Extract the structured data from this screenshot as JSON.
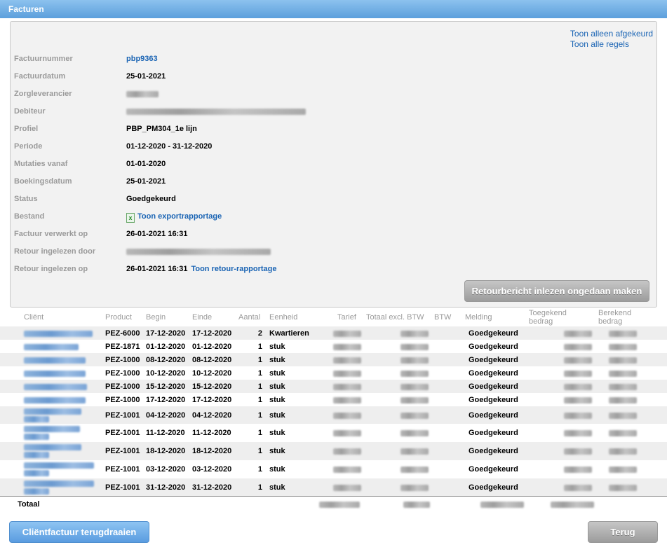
{
  "title": "Facturen",
  "links": {
    "only_rejected": "Toon alleen afgekeurd",
    "all_lines": "Toon alle regels"
  },
  "fields": [
    {
      "label": "Factuurnummer",
      "value": "pbp9363",
      "type": "link"
    },
    {
      "label": "Factuurdatum",
      "value": "25-01-2021",
      "type": "text"
    },
    {
      "label": "Zorgleverancier",
      "value": "",
      "type": "blur"
    },
    {
      "label": "Debiteur",
      "value": "",
      "type": "blur"
    },
    {
      "label": "Profiel",
      "value": "PBP_PM304_1e lijn",
      "type": "text"
    },
    {
      "label": "Periode",
      "value": "01-12-2020 -  31-12-2020",
      "type": "text"
    },
    {
      "label": "Mutaties vanaf",
      "value": "01-01-2020",
      "type": "text"
    },
    {
      "label": "Boekingsdatum",
      "value": "25-01-2021",
      "type": "text"
    },
    {
      "label": "Status",
      "value": "Goedgekeurd",
      "type": "text"
    },
    {
      "label": "Bestand",
      "value": "Toon exportrapportage",
      "type": "file"
    },
    {
      "label": "Factuur verwerkt op",
      "value": "26-01-2021 16:31",
      "type": "text"
    },
    {
      "label": "Retour ingelezen door",
      "value": "",
      "type": "blur"
    },
    {
      "label": "Retour ingelezen op",
      "value": "26-01-2021 16:31",
      "type": "text",
      "extra_link": "Toon retour-rapportage"
    }
  ],
  "undo_button": "Retourbericht inlezen ongedaan maken",
  "columns": {
    "client": "Cliënt",
    "product": "Product",
    "begin": "Begin",
    "einde": "Einde",
    "aantal": "Aantal",
    "eenheid": "Eenheid",
    "tarief": "Tarief",
    "totaal": "Totaal excl. BTW",
    "btw": "BTW",
    "melding": "Melding",
    "toegekend": "Toegekend bedrag",
    "berekend": "Berekend bedrag"
  },
  "rows": [
    {
      "product": "PEZ-6000",
      "begin": "17-12-2020",
      "einde": "17-12-2020",
      "aantal": "2",
      "eenheid": "Kwartieren",
      "melding": "Goedgekeurd"
    },
    {
      "product": "PEZ-1871",
      "begin": "01-12-2020",
      "einde": "01-12-2020",
      "aantal": "1",
      "eenheid": "stuk",
      "melding": "Goedgekeurd"
    },
    {
      "product": "PEZ-1000",
      "begin": "08-12-2020",
      "einde": "08-12-2020",
      "aantal": "1",
      "eenheid": "stuk",
      "melding": "Goedgekeurd"
    },
    {
      "product": "PEZ-1000",
      "begin": "10-12-2020",
      "einde": "10-12-2020",
      "aantal": "1",
      "eenheid": "stuk",
      "melding": "Goedgekeurd"
    },
    {
      "product": "PEZ-1000",
      "begin": "15-12-2020",
      "einde": "15-12-2020",
      "aantal": "1",
      "eenheid": "stuk",
      "melding": "Goedgekeurd"
    },
    {
      "product": "PEZ-1000",
      "begin": "17-12-2020",
      "einde": "17-12-2020",
      "aantal": "1",
      "eenheid": "stuk",
      "melding": "Goedgekeurd"
    },
    {
      "product": "PEZ-1001",
      "begin": "04-12-2020",
      "einde": "04-12-2020",
      "aantal": "1",
      "eenheid": "stuk",
      "melding": "Goedgekeurd"
    },
    {
      "product": "PEZ-1001",
      "begin": "11-12-2020",
      "einde": "11-12-2020",
      "aantal": "1",
      "eenheid": "stuk",
      "melding": "Goedgekeurd"
    },
    {
      "product": "PEZ-1001",
      "begin": "18-12-2020",
      "einde": "18-12-2020",
      "aantal": "1",
      "eenheid": "stuk",
      "melding": "Goedgekeurd"
    },
    {
      "product": "PEZ-1001",
      "begin": "03-12-2020",
      "einde": "03-12-2020",
      "aantal": "1",
      "eenheid": "stuk",
      "melding": "Goedgekeurd"
    },
    {
      "product": "PEZ-1001",
      "begin": "31-12-2020",
      "einde": "31-12-2020",
      "aantal": "1",
      "eenheid": "stuk",
      "melding": "Goedgekeurd"
    }
  ],
  "total_label": "Totaal",
  "btn_revert": "Cliëntfactuur terugdraaien",
  "btn_back": "Terug"
}
